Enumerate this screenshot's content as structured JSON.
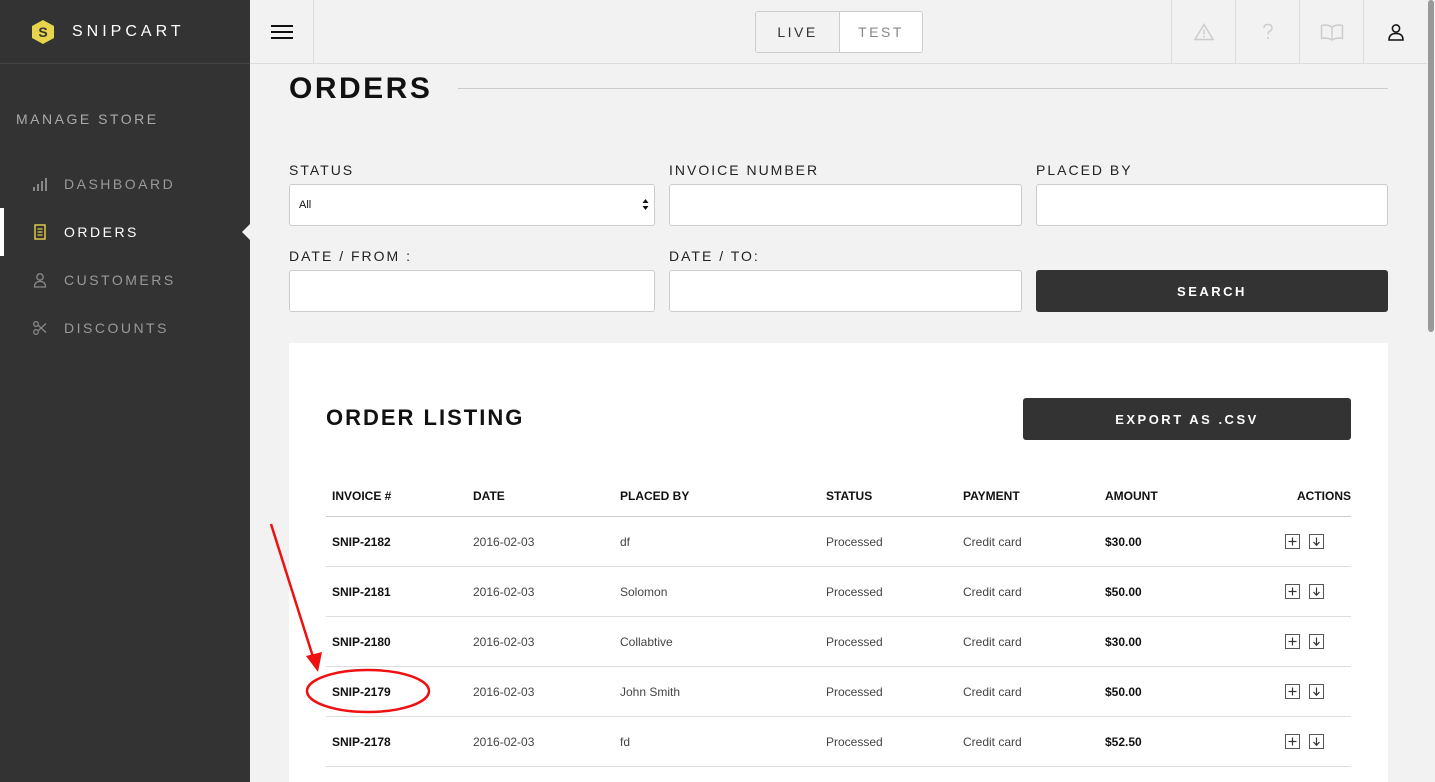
{
  "app": {
    "brand_name": "SNIPCART",
    "accent_color": "#e8d34c"
  },
  "sidebar": {
    "section_title": "MANAGE STORE",
    "items": [
      {
        "label": "DASHBOARD",
        "icon": "bar-chart-icon",
        "active": false
      },
      {
        "label": "ORDERS",
        "icon": "receipt-icon",
        "active": true
      },
      {
        "label": "CUSTOMERS",
        "icon": "user-icon",
        "active": false
      },
      {
        "label": "DISCOUNTS",
        "icon": "scissors-icon",
        "active": false
      }
    ]
  },
  "topbar": {
    "modes": {
      "live": "LIVE",
      "test": "TEST",
      "selected": "LIVE"
    },
    "icons": [
      "warning-icon",
      "help-icon",
      "book-icon",
      "account-icon"
    ]
  },
  "page": {
    "title": "ORDERS"
  },
  "filters": {
    "status_label": "STATUS",
    "status_value": "All",
    "invoice_label": "INVOICE NUMBER",
    "invoice_value": "",
    "placed_by_label": "PLACED BY",
    "placed_by_value": "",
    "date_from_label": "DATE / FROM :",
    "date_from_value": "",
    "date_to_label": "DATE / TO:",
    "date_to_value": "",
    "search_label": "SEARCH"
  },
  "listing": {
    "title": "ORDER LISTING",
    "export_label": "EXPORT AS .CSV",
    "columns": [
      "INVOICE #",
      "DATE",
      "PLACED BY",
      "STATUS",
      "PAYMENT",
      "AMOUNT",
      "ACTIONS"
    ],
    "rows": [
      {
        "invoice": "SNIP-2182",
        "date": "2016-02-03",
        "placed_by": "df",
        "status": "Processed",
        "payment": "Credit card",
        "amount": "$30.00"
      },
      {
        "invoice": "SNIP-2181",
        "date": "2016-02-03",
        "placed_by": "Solomon",
        "status": "Processed",
        "payment": "Credit card",
        "amount": "$50.00"
      },
      {
        "invoice": "SNIP-2180",
        "date": "2016-02-03",
        "placed_by": "Collabtive",
        "status": "Processed",
        "payment": "Credit card",
        "amount": "$30.00"
      },
      {
        "invoice": "SNIP-2179",
        "date": "2016-02-03",
        "placed_by": "John Smith",
        "status": "Processed",
        "payment": "Credit card",
        "amount": "$50.00",
        "highlighted": true
      },
      {
        "invoice": "SNIP-2178",
        "date": "2016-02-03",
        "placed_by": "fd",
        "status": "Processed",
        "payment": "Credit card",
        "amount": "$52.50"
      }
    ],
    "row_actions": [
      "expand-icon",
      "download-icon"
    ]
  },
  "annotation": {
    "color": "#ee1111",
    "target": "SNIP-2179"
  }
}
